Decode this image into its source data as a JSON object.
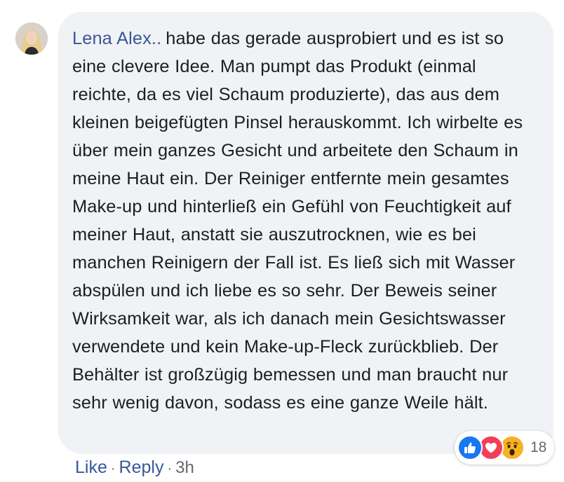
{
  "comment": {
    "author": "Lena Alex..",
    "text": "habe das gerade ausprobiert und es ist so eine clevere Idee. Man pumpt das Produkt (einmal reichte, da es viel Schaum produzierte), das aus dem kleinen beigefügten Pinsel herauskommt. Ich wirbelte es über mein ganzes Gesicht und arbeitete den Schaum in meine Haut ein. Der Reiniger entfernte mein gesamtes Make-up und hinterließ ein Gefühl von Feuchtigkeit auf meiner Haut, anstatt sie auszutrocknen, wie es bei manchen Reinigern der Fall ist. Es ließ sich mit Wasser abspülen und ich liebe es so sehr. Der Beweis seiner Wirksamkeit war, als ich danach mein Gesichtswasser verwendete und kein Make-up-Fleck zurückblieb. Der Behälter ist großzügig bemessen und man braucht nur sehr wenig davon, sodass es eine ganze Weile hält."
  },
  "reactions": {
    "icons": [
      "like-icon",
      "love-icon",
      "wow-icon"
    ],
    "count": "18"
  },
  "actions": {
    "like_label": "Like",
    "separator": "·",
    "reply_label": "Reply",
    "timestamp": "3h"
  },
  "colors": {
    "link": "#385898",
    "bubble": "#f0f2f5",
    "meta": "#65676b",
    "like": "#1877f2",
    "love": "#f33e58",
    "wow": "#f7b125"
  }
}
